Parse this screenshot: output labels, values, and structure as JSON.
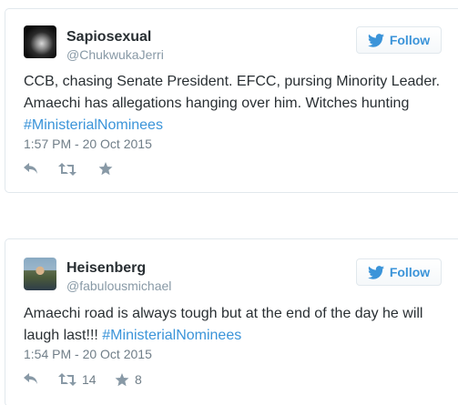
{
  "colors": {
    "link": "#3b94d9",
    "text": "#292f33",
    "muted": "#8899a6",
    "border": "#e1e8ed"
  },
  "tweets": [
    {
      "display_name": "Sapiosexual",
      "handle": "@ChukwukaJerri",
      "follow_label": "Follow",
      "text": "CCB, chasing Senate President. EFCC, pursing Minority Leader. Amaechi has allegations hanging over him. Witches hunting",
      "hashtag": "#MinisterialNominees",
      "timestamp": "1:57 PM - 20 Oct 2015",
      "retweet_count": "",
      "like_count": "",
      "icons": [
        "reply-icon",
        "retweet-icon",
        "star-icon",
        "twitter-bird-icon"
      ]
    },
    {
      "display_name": "Heisenberg",
      "handle": "@fabulousmichael",
      "follow_label": "Follow",
      "text": "Amaechi road is always tough but at the end of the day he will laugh last!!!",
      "hashtag": "#MinisterialNominees",
      "timestamp": "1:54 PM - 20 Oct 2015",
      "retweet_count": "14",
      "like_count": "8",
      "icons": [
        "reply-icon",
        "retweet-icon",
        "star-icon",
        "twitter-bird-icon"
      ]
    }
  ]
}
